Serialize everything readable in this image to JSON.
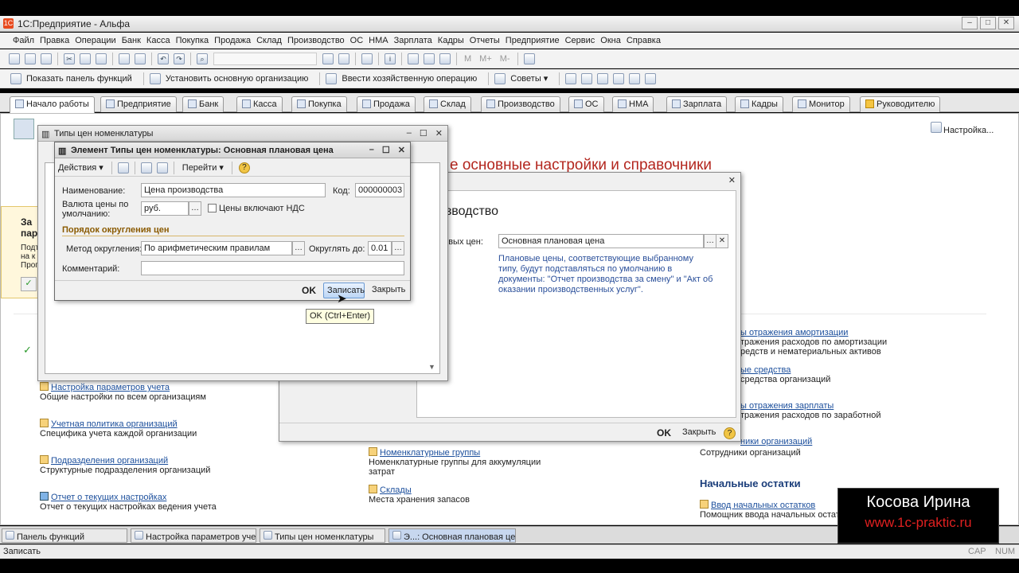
{
  "app": {
    "title": "1С:Предприятие - Альфа",
    "window_buttons": [
      "–",
      "□",
      "✕"
    ]
  },
  "menu": [
    "Файл",
    "Правка",
    "Операции",
    "Банк",
    "Касса",
    "Покупка",
    "Продажа",
    "Склад",
    "Производство",
    "ОС",
    "НМА",
    "Зарплата",
    "Кадры",
    "Отчеты",
    "Предприятие",
    "Сервис",
    "Окна",
    "Справка"
  ],
  "toolbar2": {
    "show_panel": "Показать панель функций",
    "set_org": "Установить основную организацию",
    "enter_op": "Ввести хозяйственную операцию",
    "tips": "Советы"
  },
  "tabs": [
    "Начало работы",
    "Предприятие",
    "Банк",
    "Касса",
    "Покупка",
    "Продажа",
    "Склад",
    "Производство",
    "ОС",
    "НМА",
    "Зарплата",
    "Кадры",
    "Монитор",
    "Руководителю"
  ],
  "workarea": {
    "settings_link": "Настройка...",
    "heading": "е основные настройки и справочники",
    "left_sections": [
      {
        "link": "Настройка параметров учета",
        "desc": "Общие настройки по всем организациям"
      },
      {
        "link": "Учетная политика организаций",
        "desc": "Специфика учета каждой организации"
      },
      {
        "link": "Подразделения организаций",
        "desc": "Структурные подразделения организаций"
      },
      {
        "link": "Отчет о текущих настройках",
        "desc": "Отчет о текущих настройках ведения учета"
      }
    ],
    "mid_sections": [
      {
        "link": "Номенклатурные группы",
        "desc": "Номенклатурные группы для аккумуляции затрат"
      },
      {
        "link": "Склады",
        "desc": "Места хранения запасов"
      }
    ],
    "right_sections": [
      {
        "link": "ы отражения амортизации",
        "desc": "тражения расходов по амортизации",
        "desc2": "редств и нематериальных активов"
      },
      {
        "link": "ые средства",
        "desc": "средства организаций"
      },
      {
        "link": "ы отражения зарплаты",
        "desc": "тражения расходов по заработной"
      },
      {
        "link": "ники организаций",
        "desc": "Сотрудники организаций"
      }
    ],
    "initial_balances": "Начальные остатки",
    "enter_balances_link": "Ввод начальных остатков",
    "enter_balances_desc": "Помощник ввода начальных остатк",
    "left_box": {
      "line1": "За",
      "line2": "пар",
      "t1": "Подт",
      "t2": "на к",
      "t3": "Прог"
    }
  },
  "prod_window": {
    "heading": "изводство",
    "price_label": "новых цен:",
    "price_value": "Основная плановая цена",
    "note": "Плановые цены, соответствующие выбранному типу, будут подставляться по умолчанию в документы: \"Отчет производства за смену\" и \"Акт об оказании производственных услуг\".",
    "ok": "OK",
    "close": "Закрыть"
  },
  "list_window": {
    "title": "Типы цен номенклатуры"
  },
  "element_window": {
    "title": "Элемент Типы цен номенклатуры: Основная плановая цена",
    "actions": "Действия",
    "goto": "Перейти",
    "name_label": "Наименование:",
    "name_value": "Цена производства",
    "code_label": "Код:",
    "code_value": "000000003",
    "currency_label": "Валюта цены по умолчанию:",
    "currency_value": "руб.",
    "vat_label": "Цены включают НДС",
    "rounding_section": "Порядок округления цен",
    "method_label": "Метод округления:",
    "method_value": "По арифметическим правилам",
    "round_to_label": "Округлять до:",
    "round_to_value": "0.01",
    "comment_label": "Комментарий:",
    "comment_value": "",
    "ok": "OK",
    "save": "Записать",
    "close": "Закрыть",
    "tooltip": "OK (Ctrl+Enter)"
  },
  "taskbar": [
    "Панель функций",
    "Настройка параметров уче...",
    "Типы цен номенклатуры",
    "Э...: Основная плановая цена"
  ],
  "status": {
    "text": "Записать",
    "caps": "CAP",
    "num": "NUM"
  },
  "watermark": {
    "name": "Косова Ирина",
    "url": "www.1c-praktic.ru",
    "url_color": "#e02020"
  }
}
